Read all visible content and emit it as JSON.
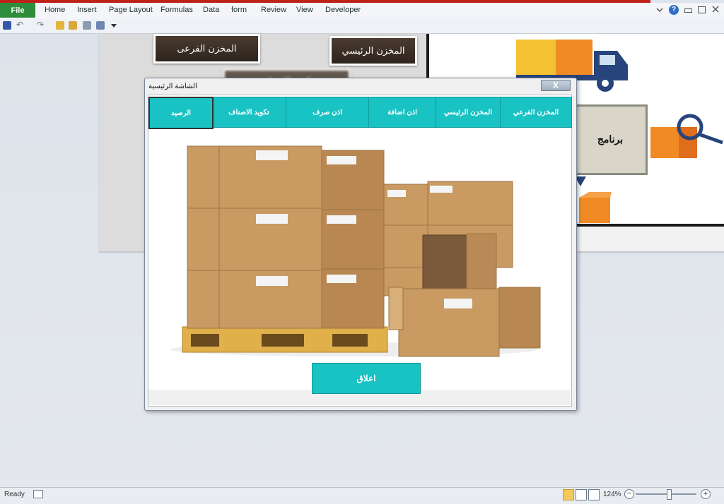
{
  "ribbon": {
    "file_label": "File",
    "tabs": [
      "Home",
      "Insert",
      "Page Layout",
      "Formulas",
      "Data",
      "form",
      "Review",
      "View",
      "Developer"
    ]
  },
  "sheet": {
    "btn_branch": "المخزن الفرعى",
    "btn_main": "المخزن الرئيسي",
    "btn_hidden": "تكويد الاصناف",
    "program_label": "برنامج"
  },
  "dialog": {
    "title": "الشاشة الرئيسية",
    "close_x": "X",
    "tabs": {
      "branch": "المخزن الفرعي",
      "main": "المخزن الرئيسي",
      "add": "اذن اضافة",
      "issue": "اذن صرف",
      "coding": "تكويد الاصناف",
      "balance": "الرصيد"
    },
    "close_button": "اعلاق"
  },
  "status": {
    "ready": "Ready",
    "zoom": "124%"
  },
  "colors": {
    "file_tab": "#2e8d3b",
    "accent_teal": "#19c2c3",
    "wood": "#3a2e25"
  }
}
